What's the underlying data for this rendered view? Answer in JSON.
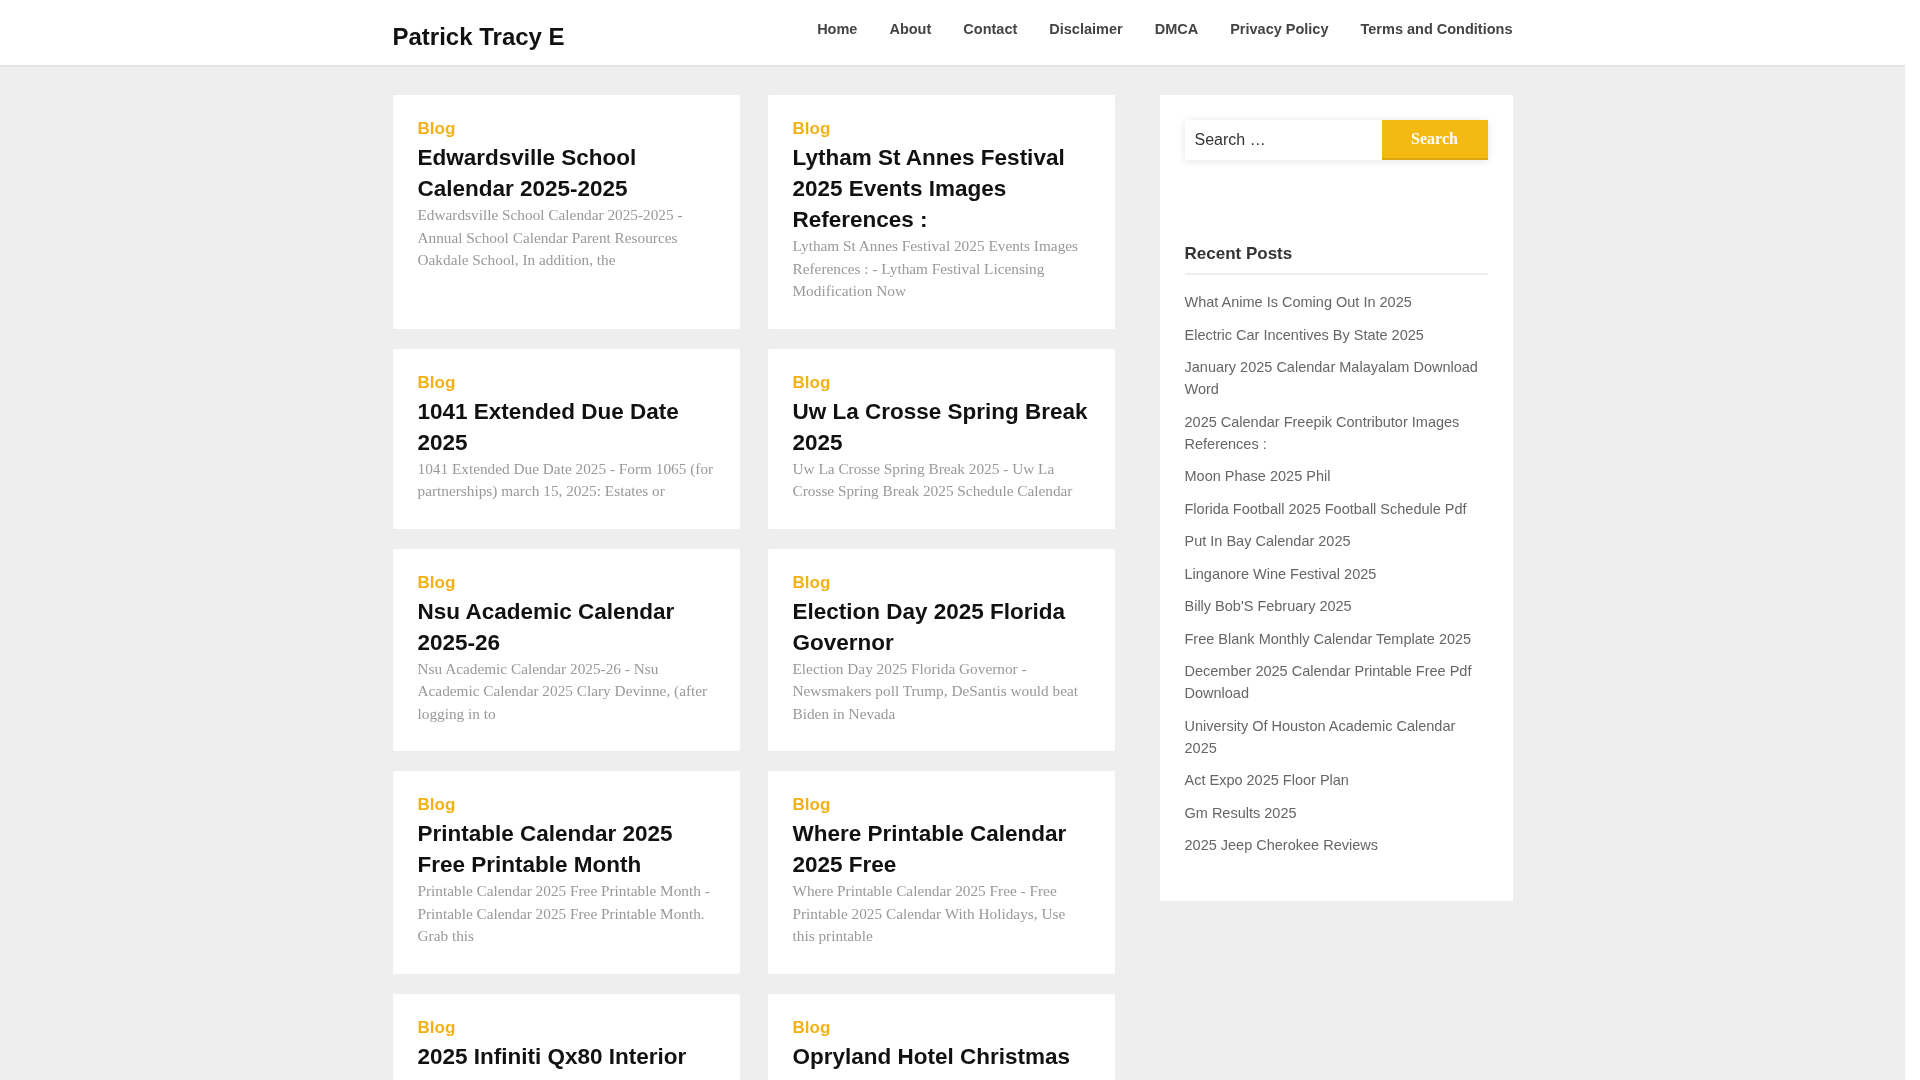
{
  "site": {
    "title": "Patrick Tracy E"
  },
  "nav": [
    "Home",
    "About",
    "Contact",
    "Disclaimer",
    "DMCA",
    "Privacy Policy",
    "Terms and Conditions"
  ],
  "posts": [
    {
      "category": "Blog",
      "title": "Edwardsville School Calendar 2025-2025",
      "excerpt": "Edwardsville School Calendar 2025-2025 - Annual School Calendar Parent Resources Oakdale School, In addition, the"
    },
    {
      "category": "Blog",
      "title": "Lytham St Annes Festival 2025 Events Images References :",
      "excerpt": "Lytham St Annes Festival 2025 Events Images References : - Lytham Festival Licensing Modification Now"
    },
    {
      "category": "Blog",
      "title": "1041 Extended Due Date 2025",
      "excerpt": "1041 Extended Due Date 2025 - Form 1065 (for partnerships) march 15, 2025: Estates or"
    },
    {
      "category": "Blog",
      "title": "Uw La Crosse Spring Break 2025",
      "excerpt": "Uw La Crosse Spring Break 2025 - Uw La Crosse Spring Break 2025 Schedule Calendar"
    },
    {
      "category": "Blog",
      "title": "Nsu Academic Calendar 2025-26",
      "excerpt": "Nsu Academic Calendar 2025-26 - Nsu Academic Calendar 2025 Clary Devinne, (after logging in to"
    },
    {
      "category": "Blog",
      "title": "Election Day 2025 Florida Governor",
      "excerpt": "Election Day 2025 Florida Governor - Newsmakers poll Trump, DeSantis would beat Biden in Nevada"
    },
    {
      "category": "Blog",
      "title": "Printable Calendar 2025 Free Printable Month",
      "excerpt": "Printable Calendar 2025 Free Printable Month - Printable Calendar 2025 Free Printable Month. Grab this"
    },
    {
      "category": "Blog",
      "title": "Where Printable Calendar 2025 Free",
      "excerpt": "Where Printable Calendar 2025 Free - Free Printable 2025 Calendar With Holidays, Use this printable"
    },
    {
      "category": "Blog",
      "title": "2025 Infiniti Qx80 Interior"
    },
    {
      "category": "Blog",
      "title": "Opryland Hotel Christmas"
    }
  ],
  "sidebar": {
    "search": {
      "placeholder": "Search …",
      "button": "Search"
    },
    "recent_posts": {
      "heading": "Recent Posts",
      "items": [
        "What Anime Is Coming Out In 2025",
        "Electric Car Incentives By State 2025",
        "January 2025 Calendar Malayalam Download Word",
        "2025 Calendar Freepik Contributor Images References :",
        "Moon Phase 2025 Phil",
        "Florida Football 2025 Football Schedule Pdf",
        "Put In Bay Calendar 2025",
        "Linganore Wine Festival 2025",
        "Billy Bob'S February 2025",
        "Free Blank Monthly Calendar Template 2025",
        "December 2025 Calendar Printable Free Pdf Download",
        "University Of Houston Academic Calendar 2025",
        "Act Expo 2025 Floor Plan",
        "Gm Results 2025",
        "2025 Jeep Cherokee Reviews"
      ]
    }
  }
}
